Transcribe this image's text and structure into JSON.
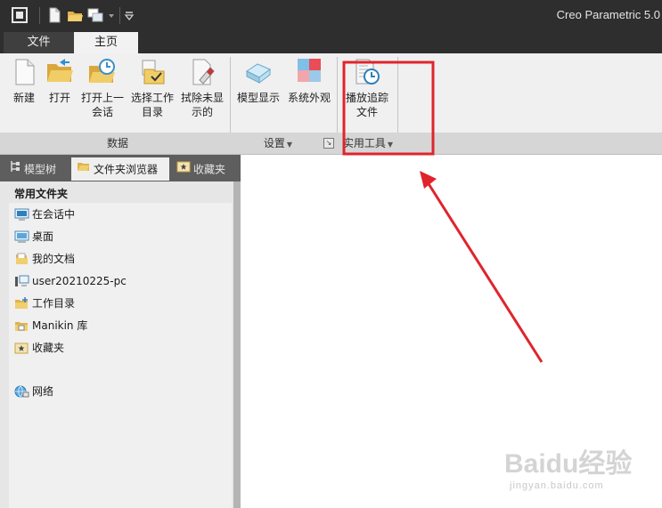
{
  "window": {
    "title": "Creo Parametric 5.0"
  },
  "ribbon_tabs": [
    {
      "label": "文件",
      "active": false
    },
    {
      "label": "主页",
      "active": true
    }
  ],
  "groups": {
    "data": {
      "label": "数据",
      "buttons": [
        {
          "label": "新建",
          "icon": "new-file-icon"
        },
        {
          "label": "打开",
          "icon": "open-folder-icon"
        },
        {
          "label": "打开上一\n会话",
          "icon": "open-last-session-icon"
        },
        {
          "label": "选择工作\n目录",
          "icon": "select-working-directory-icon"
        },
        {
          "label": "拭除未显\n示的",
          "icon": "erase-not-displayed-icon"
        }
      ]
    },
    "settings": {
      "label": "设置",
      "buttons": [
        {
          "label": "模型显示",
          "icon": "model-display-icon"
        },
        {
          "label": "系统外观",
          "icon": "system-appearance-icon"
        }
      ]
    },
    "utilities": {
      "label": "实用工具",
      "buttons": [
        {
          "label": "播放追踪\n文件",
          "icon": "play-trail-file-icon"
        }
      ]
    }
  },
  "navigator": {
    "tabs": [
      {
        "label": "模型树",
        "icon": "model-tree-icon",
        "active": false
      },
      {
        "label": "文件夹浏览器",
        "icon": "folder-browser-icon",
        "active": true
      },
      {
        "label": "收藏夹",
        "icon": "favorites-icon",
        "active": false
      }
    ],
    "heading": "常用文件夹",
    "items": [
      {
        "label": "在会话中",
        "icon": "in-session-icon"
      },
      {
        "label": "桌面",
        "icon": "desktop-icon"
      },
      {
        "label": "我的文档",
        "icon": "my-documents-icon"
      },
      {
        "label": "user20210225-pc",
        "icon": "computer-icon"
      },
      {
        "label": "工作目录",
        "icon": "working-directory-icon"
      },
      {
        "label": "Manikin 库",
        "icon": "manikin-library-icon"
      },
      {
        "label": "收藏夹",
        "icon": "favorites-folder-icon"
      },
      {
        "label": "网络",
        "icon": "network-icon"
      }
    ]
  },
  "watermark": {
    "brand": "Baidu经验",
    "url": "jingyan.baidu.com"
  },
  "colors": {
    "annotation": "#e0242c",
    "titlebar": "#2e2e2e",
    "ribbon": "#f0f0f0"
  }
}
